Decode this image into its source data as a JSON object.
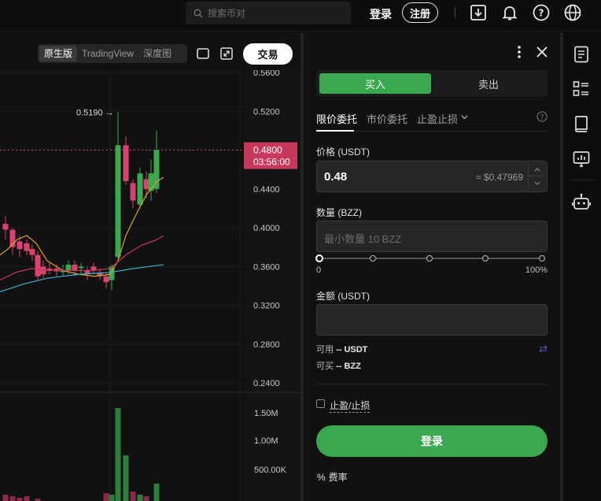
{
  "topbar": {
    "search_placeholder": "搜索币对",
    "login": "登录",
    "register": "注册"
  },
  "chart": {
    "views": [
      "原生版",
      "TradingView",
      "深度图"
    ],
    "active_view": "原生版",
    "trade_button": "交易",
    "price_ticks": [
      "0.5600",
      "0.5200",
      "0.4800",
      "0.4400",
      "0.4000",
      "0.3600",
      "0.3200",
      "0.2800",
      "0.2400"
    ],
    "high_label": "0.5190",
    "current_price": "0.4800",
    "countdown": "03:56:00",
    "volume_ticks": [
      "1.50M",
      "1.00M",
      "500.00K"
    ],
    "colors": {
      "up": "#3aa84e",
      "down": "#d9436f",
      "ma_short": "#e0a020",
      "ma_mid": "#c8385a",
      "ma_long": "#3ab0d0"
    }
  },
  "panel": {
    "buy": "买入",
    "sell": "卖出",
    "order_tabs": [
      "限价委托",
      "市价委托",
      "止盈止损"
    ],
    "price_label": "价格 (USDT)",
    "price_value": "0.48",
    "price_approx": "≈ $0.47969",
    "qty_label": "数量 (BZZ)",
    "qty_placeholder": "最小数量 10 BZZ",
    "slider_min": "0",
    "slider_max": "100%",
    "amount_label": "金额 (USDT)",
    "available_label": "可用",
    "available_value": "-- USDT",
    "can_buy_label": "可买",
    "can_buy_value": "-- BZZ",
    "tpsl_label": "止盈/止损",
    "login_button": "登录",
    "fee_label": "费率",
    "accent": "#3aa84e"
  }
}
